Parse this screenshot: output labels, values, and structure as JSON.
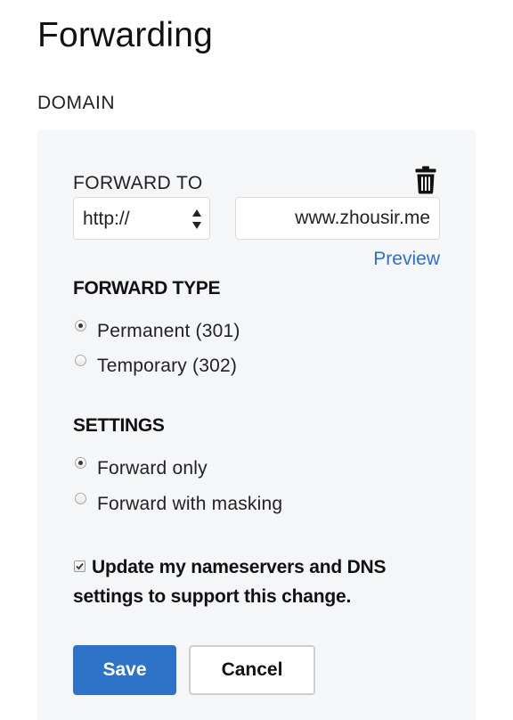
{
  "page": {
    "title": "Forwarding",
    "section_label": "DOMAIN"
  },
  "forward_to": {
    "label": "FORWARD TO",
    "protocol_selected": "http://",
    "url_value": "www.zhousir.me",
    "preview_link": "Preview",
    "delete_icon": "trash-icon"
  },
  "forward_type": {
    "heading": "FORWARD TYPE",
    "options": [
      {
        "label": "Permanent (301)",
        "checked": true
      },
      {
        "label": "Temporary (302)",
        "checked": false
      }
    ]
  },
  "settings": {
    "heading": "SETTINGS",
    "options": [
      {
        "label": "Forward only",
        "checked": true
      },
      {
        "label": "Forward with masking",
        "checked": false
      }
    ]
  },
  "update_dns": {
    "label": "Update my nameservers and DNS settings to support this change.",
    "checked": true
  },
  "actions": {
    "save_label": "Save",
    "cancel_label": "Cancel"
  },
  "colors": {
    "accent": "#2f73c9",
    "link": "#2f6fc9",
    "panel_bg": "#f5f6f7"
  }
}
